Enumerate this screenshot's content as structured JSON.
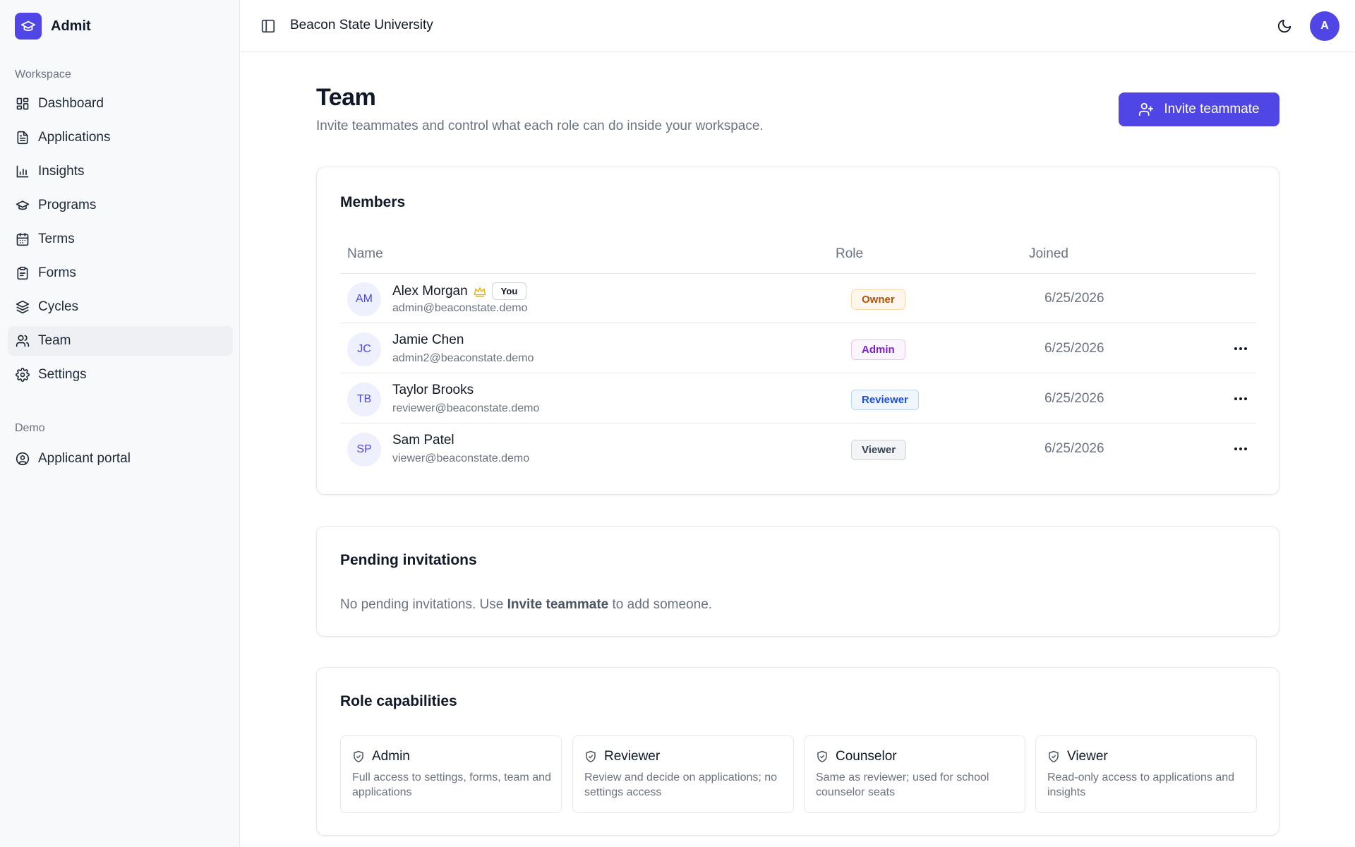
{
  "brand": {
    "name": "Admit"
  },
  "sidebar": {
    "workspace_label": "Workspace",
    "items": [
      {
        "label": "Dashboard",
        "icon": "dashboard-icon"
      },
      {
        "label": "Applications",
        "icon": "file-text-icon"
      },
      {
        "label": "Insights",
        "icon": "bar-chart-icon"
      },
      {
        "label": "Programs",
        "icon": "graduation-cap-icon"
      },
      {
        "label": "Terms",
        "icon": "calendar-icon"
      },
      {
        "label": "Forms",
        "icon": "clipboard-icon"
      },
      {
        "label": "Cycles",
        "icon": "layers-icon"
      },
      {
        "label": "Team",
        "icon": "users-icon",
        "active": true
      },
      {
        "label": "Settings",
        "icon": "gear-icon"
      }
    ],
    "demo_label": "Demo",
    "demo_items": [
      {
        "label": "Applicant portal",
        "icon": "user-circle-icon"
      }
    ]
  },
  "header": {
    "org_name": "Beacon State University",
    "avatar_initial": "A"
  },
  "page": {
    "title": "Team",
    "subtitle": "Invite teammates and control what each role can do inside your workspace.",
    "invite_button": "Invite teammate"
  },
  "members": {
    "title": "Members",
    "columns": {
      "name": "Name",
      "role": "Role",
      "joined": "Joined"
    },
    "rows": [
      {
        "initials": "AM",
        "name": "Alex Morgan",
        "email": "admin@beaconstate.demo",
        "role": "Owner",
        "joined": "6/25/2026",
        "you": "You"
      },
      {
        "initials": "JC",
        "name": "Jamie Chen",
        "email": "admin2@beaconstate.demo",
        "role": "Admin",
        "joined": "6/25/2026"
      },
      {
        "initials": "TB",
        "name": "Taylor Brooks",
        "email": "reviewer@beaconstate.demo",
        "role": "Reviewer",
        "joined": "6/25/2026"
      },
      {
        "initials": "SP",
        "name": "Sam Patel",
        "email": "viewer@beaconstate.demo",
        "role": "Viewer",
        "joined": "6/25/2026"
      }
    ]
  },
  "pending": {
    "title": "Pending invitations",
    "text_before": "No pending invitations. Use ",
    "text_bold": "Invite teammate",
    "text_after": " to add someone."
  },
  "capabilities": {
    "title": "Role capabilities",
    "items": [
      {
        "name": "Admin",
        "desc": "Full access to settings, forms, team and applications"
      },
      {
        "name": "Reviewer",
        "desc": "Review and decide on applications; no settings access"
      },
      {
        "name": "Counselor",
        "desc": "Same as reviewer; used for school counselor seats"
      },
      {
        "name": "Viewer",
        "desc": "Read-only access to applications and insights"
      }
    ]
  },
  "colors": {
    "accent": "#4f46e5",
    "owner_badge": "#b45309",
    "admin_badge": "#7e22ce",
    "reviewer_badge": "#1d4ed8",
    "viewer_badge": "#374151",
    "crown": "#eab308"
  }
}
